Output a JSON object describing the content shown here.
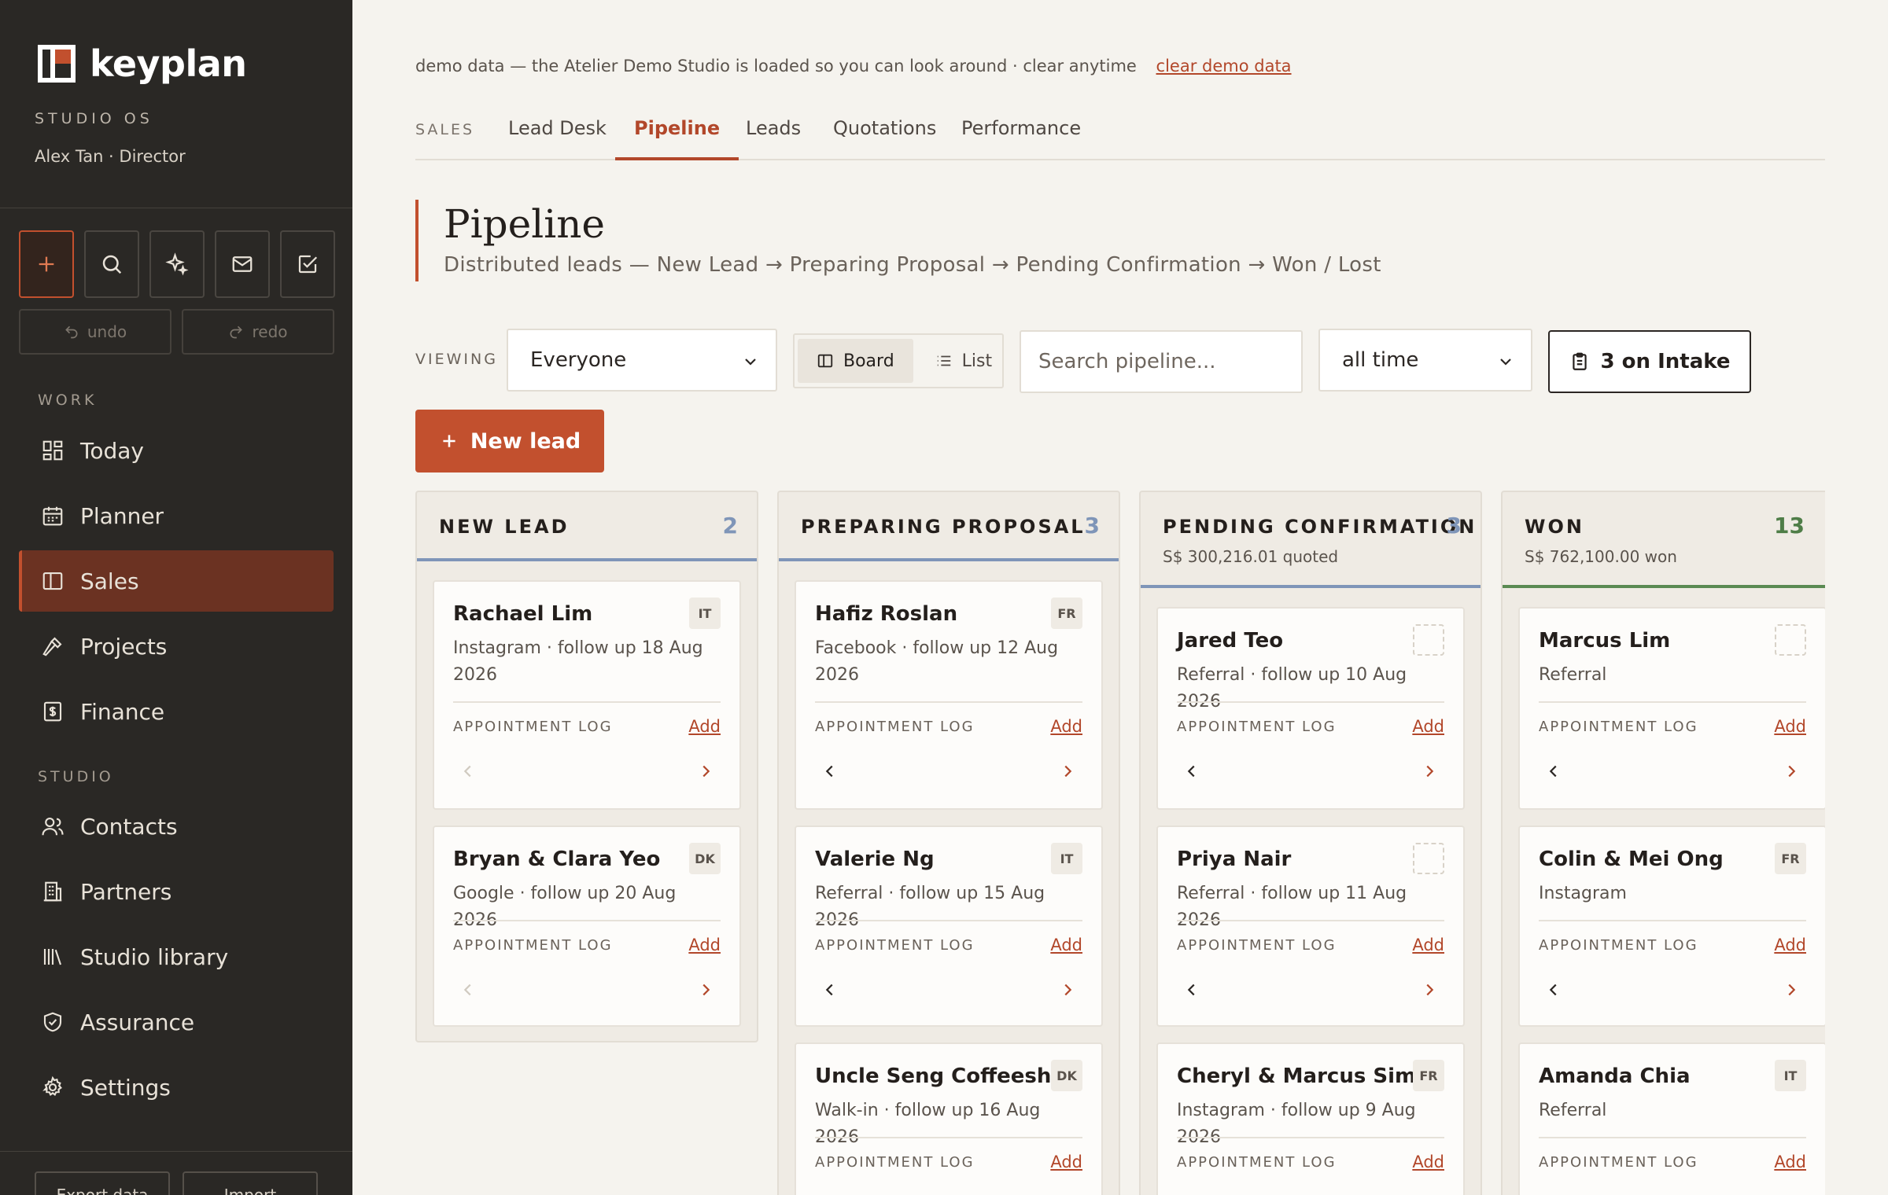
{
  "app": {
    "name": "keyplan",
    "subtitle": "STUDIO OS",
    "user": "Alex Tan · Director"
  },
  "quick_actions": [
    {
      "name": "add",
      "icon": "plus-icon"
    },
    {
      "name": "search",
      "icon": "search-icon"
    },
    {
      "name": "ai",
      "icon": "sparkle-icon"
    },
    {
      "name": "mail",
      "icon": "mail-icon"
    },
    {
      "name": "tasks",
      "icon": "checkbox-icon"
    }
  ],
  "history": {
    "undo": "undo",
    "redo": "redo"
  },
  "nav": {
    "work_label": "WORK",
    "studio_label": "STUDIO",
    "work": [
      {
        "label": "Today",
        "icon": "grid-icon"
      },
      {
        "label": "Planner",
        "icon": "calendar-icon"
      },
      {
        "label": "Sales",
        "icon": "board-icon",
        "active": true
      },
      {
        "label": "Projects",
        "icon": "hammer-icon"
      },
      {
        "label": "Finance",
        "icon": "receipt-icon"
      }
    ],
    "studio": [
      {
        "label": "Contacts",
        "icon": "users-icon"
      },
      {
        "label": "Partners",
        "icon": "building-icon"
      },
      {
        "label": "Studio library",
        "icon": "library-icon"
      },
      {
        "label": "Assurance",
        "icon": "shield-icon"
      },
      {
        "label": "Settings",
        "icon": "gear-icon"
      }
    ],
    "bottom": {
      "export": "Export data",
      "import": "Import"
    }
  },
  "demo": {
    "text": "demo data — the Atelier Demo Studio is loaded so you can look around · clear anytime",
    "link": "clear demo data"
  },
  "tabs": {
    "section": "SALES",
    "items": [
      "Lead Desk",
      "Pipeline",
      "Leads",
      "Quotations",
      "Performance"
    ],
    "active": "Pipeline"
  },
  "page": {
    "title": "Pipeline",
    "subtitle": "Distributed leads — New Lead → Preparing Proposal → Pending Confirmation → Won / Lost"
  },
  "toolbar": {
    "viewing_label": "VIEWING",
    "viewing_value": "Everyone",
    "view_board": "Board",
    "view_list": "List",
    "search_placeholder": "Search pipeline...",
    "period_value": "all time",
    "intake": "3 on Intake",
    "new_lead": "New lead"
  },
  "accent_colors": {
    "brand": "#c2502e",
    "sidebar": "#2a2825",
    "lane_blue": "#7f95b8",
    "lane_green": "#5a8a52"
  },
  "columns": [
    {
      "title": "NEW LEAD",
      "count": "2",
      "subtitle": "",
      "cards": [
        {
          "name": "Rachael Lim",
          "tag": "IT",
          "meta": "Instagram · follow up 18 Aug 2026",
          "log_label": "APPOINTMENT LOG",
          "add": "Add"
        },
        {
          "name": "Bryan & Clara Yeo",
          "tag": "DK",
          "meta": "Google · follow up 20 Aug 2026",
          "log_label": "APPOINTMENT LOG",
          "add": "Add"
        }
      ]
    },
    {
      "title": "PREPARING PROPOSAL",
      "count": "3",
      "subtitle": "",
      "cards": [
        {
          "name": "Hafiz Roslan",
          "tag": "FR",
          "meta": "Facebook · follow up 12 Aug 2026",
          "log_label": "APPOINTMENT LOG",
          "add": "Add"
        },
        {
          "name": "Valerie Ng",
          "tag": "IT",
          "meta": "Referral · follow up 15 Aug 2026",
          "log_label": "APPOINTMENT LOG",
          "add": "Add"
        },
        {
          "name": "Uncle Seng Coffeeshop",
          "tag": "DK",
          "meta": "Walk-in · follow up 16 Aug 2026",
          "log_label": "APPOINTMENT LOG",
          "add": "Add"
        }
      ]
    },
    {
      "title": "PENDING CONFIRMATION",
      "count": "3",
      "subtitle": "S$ 300,216.01 quoted",
      "cards": [
        {
          "name": "Jared Teo",
          "tag": "",
          "meta": "Referral · follow up 10 Aug 2026",
          "log_label": "APPOINTMENT LOG",
          "add": "Add"
        },
        {
          "name": "Priya Nair",
          "tag": "",
          "meta": "Referral · follow up 11 Aug 2026",
          "log_label": "APPOINTMENT LOG",
          "add": "Add"
        },
        {
          "name": "Cheryl & Marcus Sim",
          "tag": "FR",
          "meta": "Instagram · follow up 9 Aug 2026",
          "log_label": "APPOINTMENT LOG",
          "add": "Add"
        }
      ]
    },
    {
      "title": "WON",
      "count": "13",
      "subtitle": "S$ 762,100.00 won",
      "cards": [
        {
          "name": "Marcus Lim",
          "tag": "",
          "meta": "Referral",
          "log_label": "APPOINTMENT LOG",
          "add": "Add"
        },
        {
          "name": "Colin & Mei Ong",
          "tag": "FR",
          "meta": "Instagram",
          "log_label": "APPOINTMENT LOG",
          "add": "Add"
        },
        {
          "name": "Amanda Chia",
          "tag": "IT",
          "meta": "Referral",
          "log_label": "APPOINTMENT LOG",
          "add": "Add"
        }
      ]
    }
  ]
}
